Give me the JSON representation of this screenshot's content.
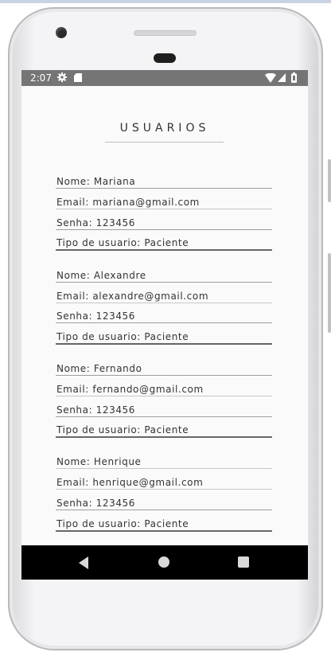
{
  "status_bar": {
    "time": "2:07",
    "icons": [
      "gear-icon",
      "sd-card-icon",
      "wifi-icon",
      "signal-icon",
      "battery-icon"
    ]
  },
  "screen": {
    "title": "USUARIOS"
  },
  "users": [
    {
      "nome": "Nome: Mariana",
      "email": "Email: mariana@gmail.com",
      "senha": "Senha: 123456",
      "tipo": "Tipo de usuario: Paciente"
    },
    {
      "nome": "Nome: Alexandre",
      "email": "Email: alexandre@gmail.com",
      "senha": "Senha: 123456",
      "tipo": "Tipo de usuario: Paciente"
    },
    {
      "nome": "Nome: Fernando",
      "email": "Email: fernando@gmail.com",
      "senha": "Senha: 123456",
      "tipo": "Tipo de usuario: Paciente"
    },
    {
      "nome": "Nome: Henrique",
      "email": "Email: henrique@gmail.com",
      "senha": "Senha: 123456",
      "tipo": "Tipo de usuario: Paciente"
    }
  ],
  "nav_bar": {
    "icons": [
      "back-icon",
      "home-icon",
      "recents-icon"
    ]
  },
  "colors": {
    "status_bar": "#757575",
    "screen_background": "#fafafa",
    "nav_bar": "#000000",
    "text": "#333333"
  }
}
